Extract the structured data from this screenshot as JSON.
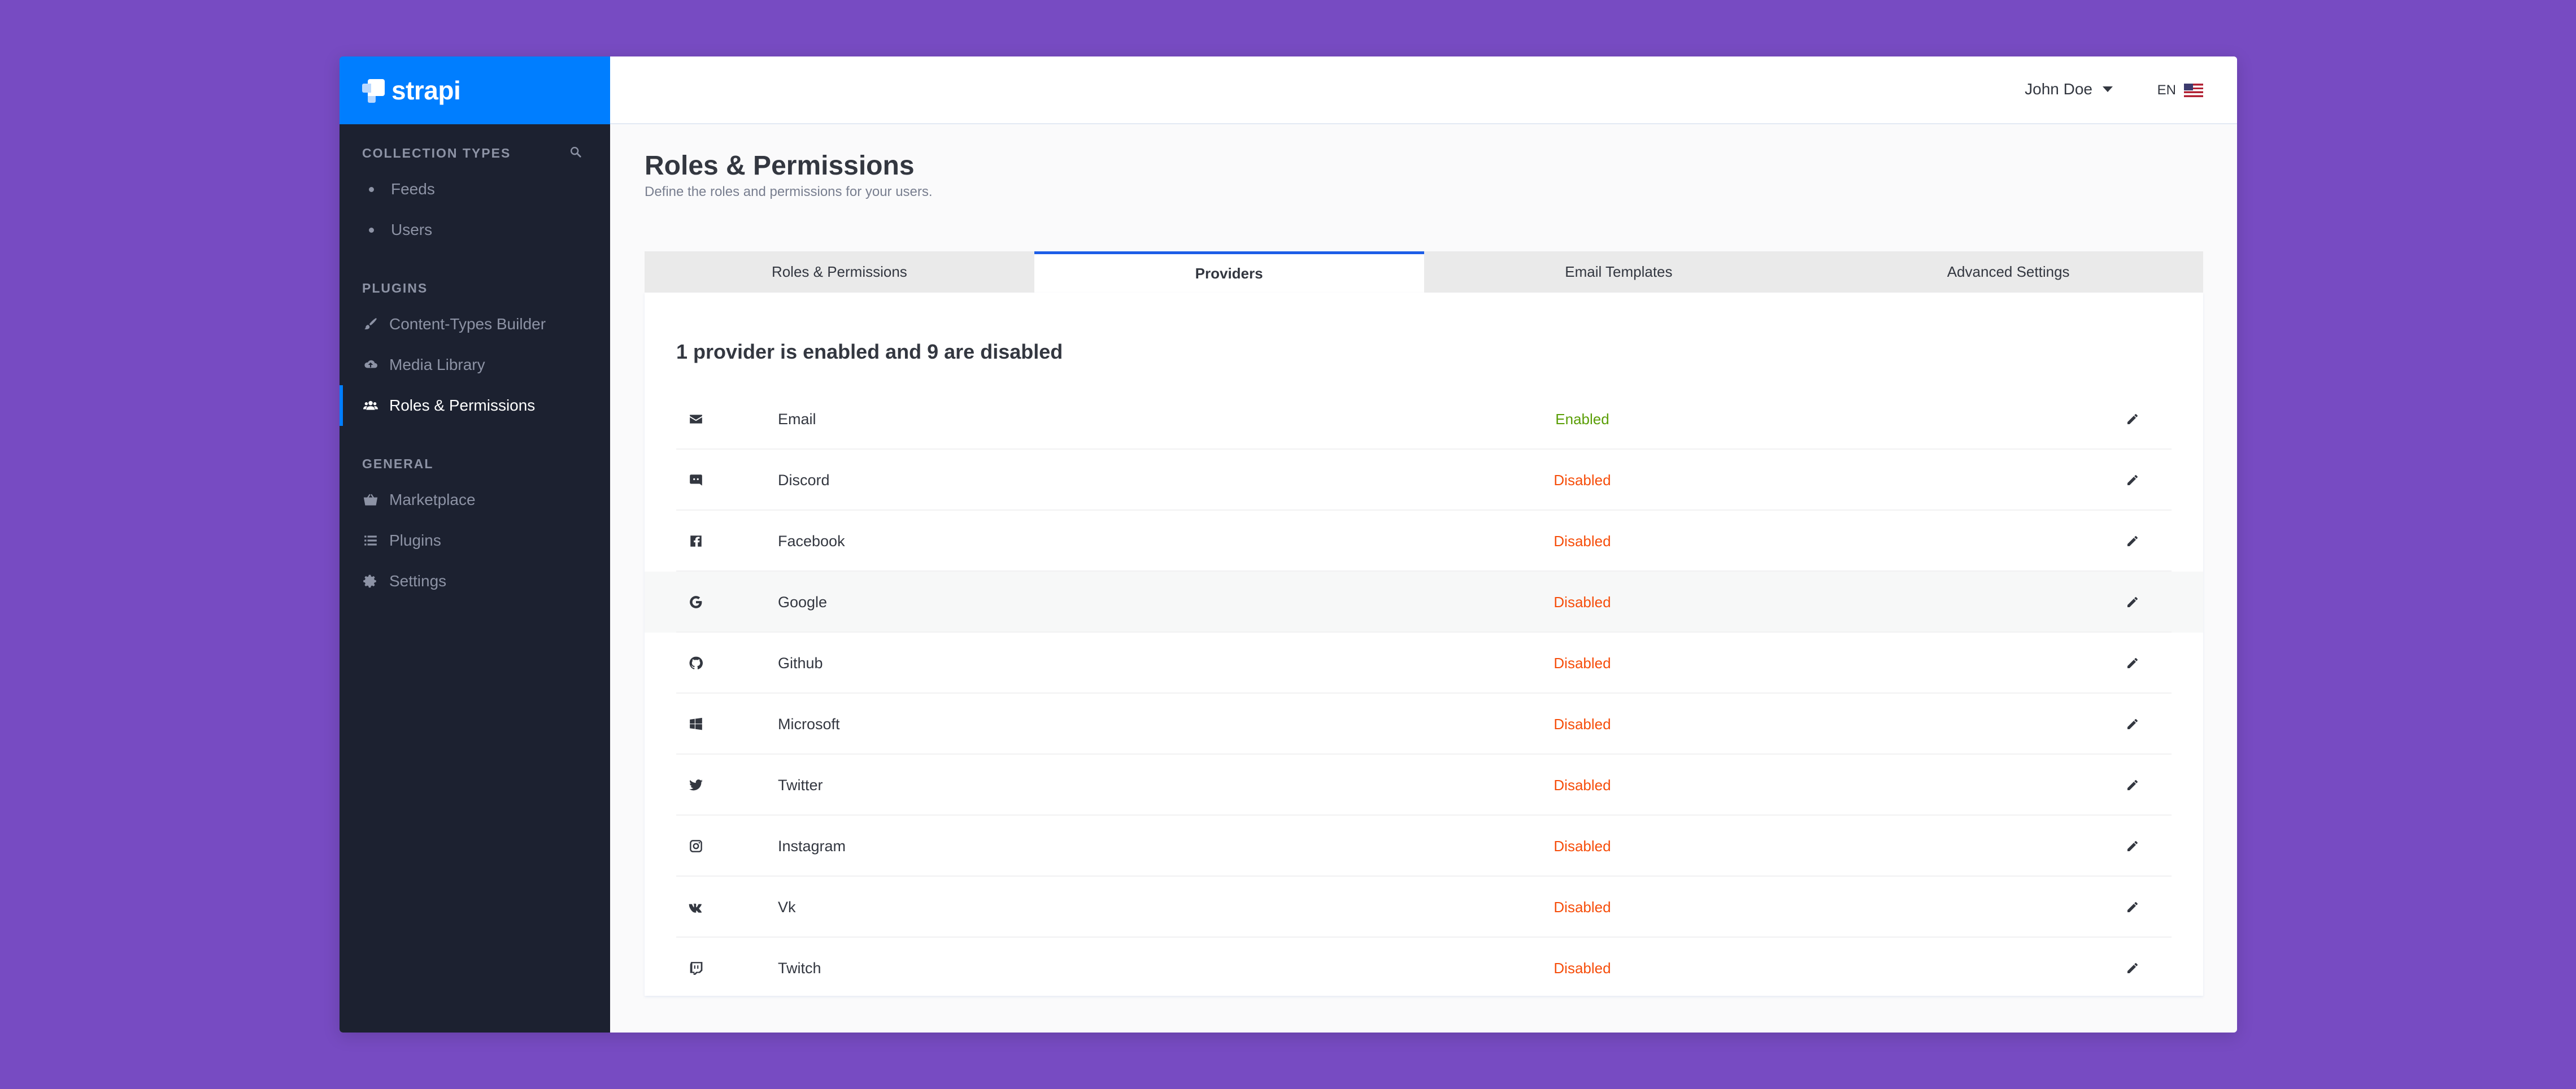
{
  "brand": {
    "name": "strapi"
  },
  "sidebar": {
    "collection_types_title": "COLLECTION TYPES",
    "collection_types": [
      {
        "label": "Feeds"
      },
      {
        "label": "Users"
      }
    ],
    "plugins_title": "PLUGINS",
    "plugins": [
      {
        "label": "Content-Types Builder",
        "icon": "paint-brush-icon"
      },
      {
        "label": "Media Library",
        "icon": "cloud-upload-icon"
      },
      {
        "label": "Roles & Permissions",
        "icon": "users-icon",
        "active": true
      }
    ],
    "general_title": "GENERAL",
    "general": [
      {
        "label": "Marketplace",
        "icon": "shopping-basket-icon"
      },
      {
        "label": "Plugins",
        "icon": "list-icon"
      },
      {
        "label": "Settings",
        "icon": "gear-icon"
      }
    ]
  },
  "topbar": {
    "user_name": "John Doe",
    "language": "EN"
  },
  "page": {
    "title": "Roles & Permissions",
    "subtitle": "Define the roles and permissions for your users."
  },
  "tabs": [
    {
      "label": "Roles & Permissions"
    },
    {
      "label": "Providers",
      "active": true
    },
    {
      "label": "Email Templates"
    },
    {
      "label": "Advanced Settings"
    }
  ],
  "providers": {
    "summary": "1 provider is enabled and 9 are disabled",
    "rows": [
      {
        "name": "Email",
        "status": "Enabled",
        "icon": "envelope-icon"
      },
      {
        "name": "Discord",
        "status": "Disabled",
        "icon": "discord-icon"
      },
      {
        "name": "Facebook",
        "status": "Disabled",
        "icon": "facebook-icon"
      },
      {
        "name": "Google",
        "status": "Disabled",
        "icon": "google-icon"
      },
      {
        "name": "Github",
        "status": "Disabled",
        "icon": "github-icon"
      },
      {
        "name": "Microsoft",
        "status": "Disabled",
        "icon": "windows-icon"
      },
      {
        "name": "Twitter",
        "status": "Disabled",
        "icon": "twitter-icon"
      },
      {
        "name": "Instagram",
        "status": "Disabled",
        "icon": "instagram-icon"
      },
      {
        "name": "Vk",
        "status": "Disabled",
        "icon": "vk-icon"
      },
      {
        "name": "Twitch",
        "status": "Disabled",
        "icon": "twitch-icon"
      }
    ]
  },
  "colors": {
    "brand_blue": "#007eff",
    "sidebar_bg": "#1c2130",
    "enabled": "#5a9e06",
    "disabled": "#f64d0a",
    "page_bg": "#774bc2"
  }
}
